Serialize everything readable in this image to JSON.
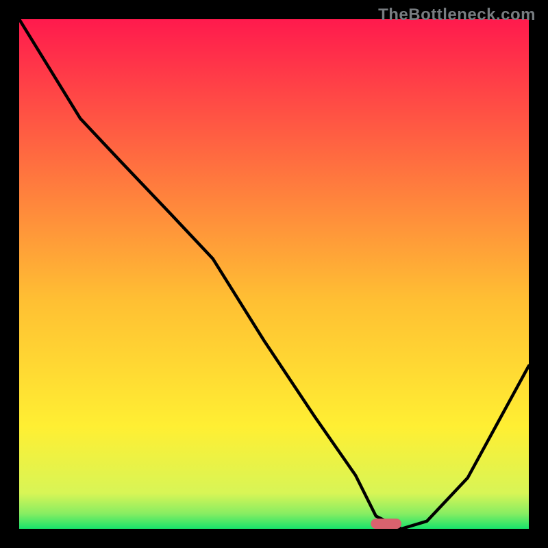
{
  "watermark": "TheBottleneck.com",
  "chart_data": {
    "type": "line",
    "title": "",
    "xlabel": "",
    "ylabel": "",
    "xlim": [
      0,
      100
    ],
    "ylim": [
      0,
      100
    ],
    "grid": false,
    "legend": false,
    "background_gradient": {
      "from_color": "#ff1a4d",
      "via_color": "#ffef33",
      "to_color": "#17e36b"
    },
    "marker": {
      "x": 72,
      "y": 0,
      "color": "#d9626e",
      "width": 6,
      "height": 2,
      "radius": 1
    },
    "series": [
      {
        "name": "bottleneck-curve",
        "x": [
          0,
          12,
          20,
          30,
          38,
          48,
          58,
          66,
          70,
          75,
          80,
          88,
          94,
          100
        ],
        "values": [
          100,
          80.5,
          72,
          61.5,
          53,
          37,
          22,
          10.5,
          2.5,
          0,
          1.5,
          10,
          21,
          32
        ]
      }
    ]
  }
}
